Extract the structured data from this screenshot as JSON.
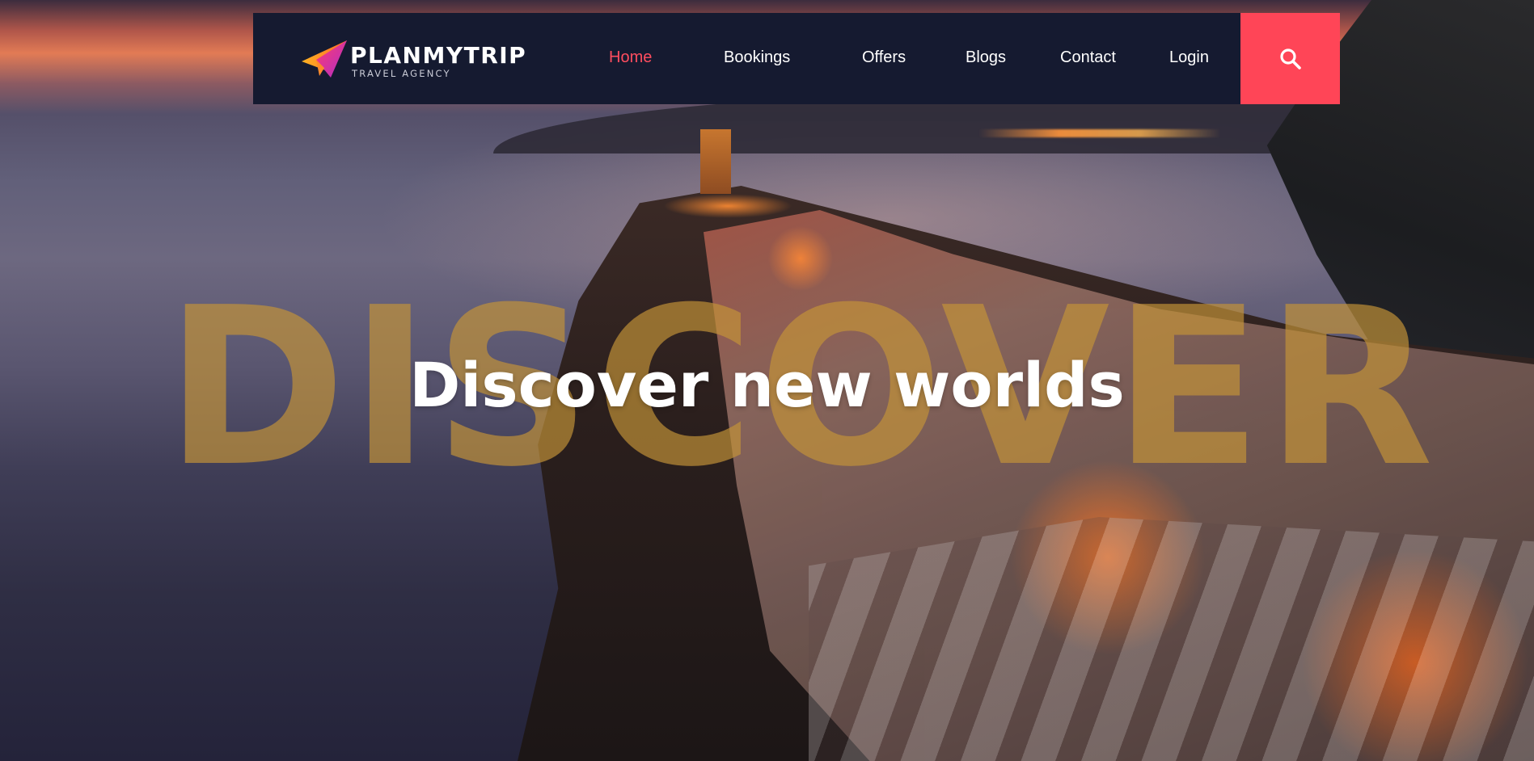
{
  "brand": {
    "name": "PLANMYTRIP",
    "tagline": "TRAVEL AGENCY",
    "colors": {
      "navbar": "#151a30",
      "accent": "#ff4557",
      "active_link": "#ff4d5f",
      "watermark": "#c49438"
    }
  },
  "nav": {
    "items": [
      {
        "label": "Home",
        "active": true
      },
      {
        "label": "Bookings",
        "active": false
      },
      {
        "label": "Offers",
        "active": false
      },
      {
        "label": "Blogs",
        "active": false
      },
      {
        "label": "Contact",
        "active": false
      },
      {
        "label": "Login",
        "active": false
      }
    ],
    "search_icon": "search-icon"
  },
  "hero": {
    "watermark": "DISCOVER",
    "headline": "Discover new worlds"
  }
}
